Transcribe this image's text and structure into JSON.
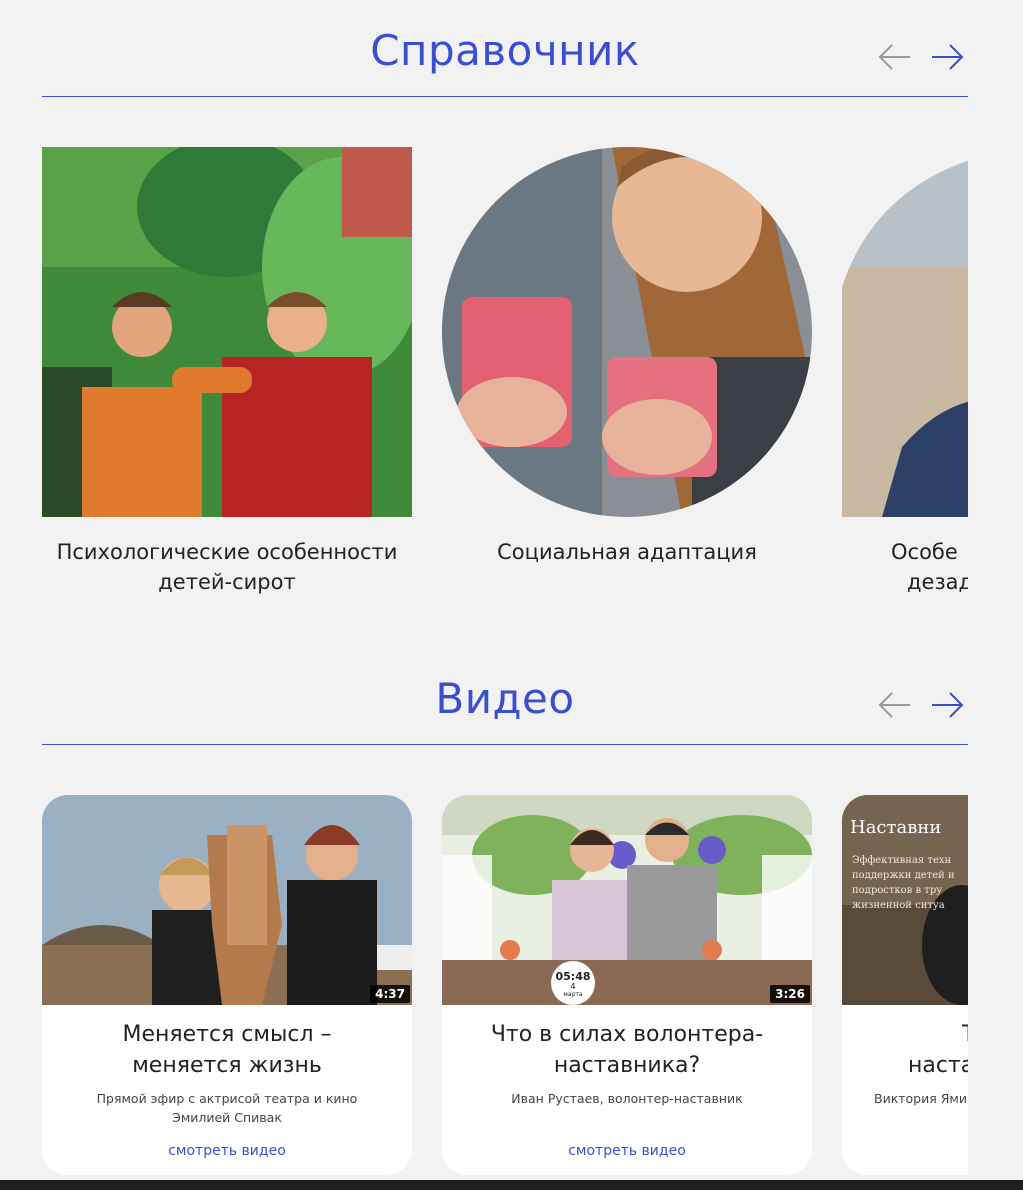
{
  "reference": {
    "title": "Справочник",
    "items": [
      {
        "caption_line1": "Психологические особенности",
        "caption_line2": "детей-сирот"
      },
      {
        "caption_line1": "Социальная адаптация",
        "caption_line2": ""
      },
      {
        "caption_line1": "Особе",
        "caption_line2": "дезад"
      }
    ]
  },
  "video": {
    "title": "Видео",
    "items": [
      {
        "title": "Меняется смысл – меняется жизнь",
        "subtitle": "Прямой эфир с актрисой театра и кино Эмилией Спивак",
        "duration": "4:37",
        "link": "смотреть видео"
      },
      {
        "title": "Что в силах волонтера-наставника?",
        "subtitle": "Иван Рустаев, волонтер-наставник",
        "duration": "3:26",
        "link": "смотреть видео",
        "clock_time": "05:48",
        "clock_date": "4",
        "clock_month": "марта"
      },
      {
        "title": "Т наста",
        "subtitle": "Виктория Ями",
        "thumb_title": "Наставни",
        "thumb_text": "Эффективная техн поддержки детей и подростков в тру жизненной ситуа"
      }
    ]
  },
  "colors": {
    "accent": "#3a4fd0",
    "background": "#f2f2f2"
  }
}
